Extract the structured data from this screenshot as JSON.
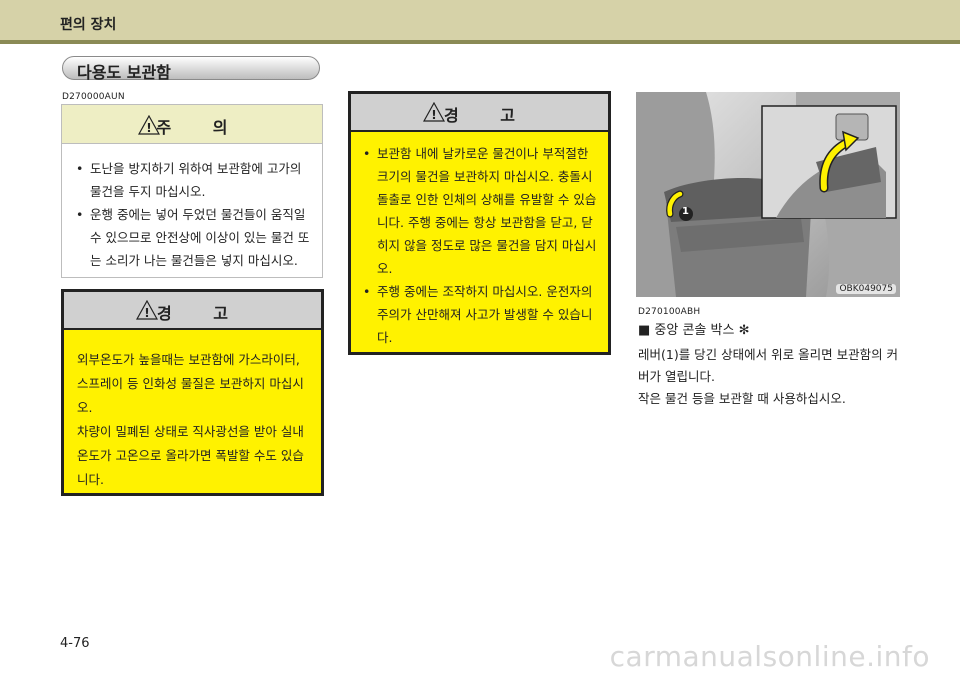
{
  "header": {
    "title": "편의 장치"
  },
  "section": {
    "title": "다용도 보관함"
  },
  "codes": {
    "caution": "D270000AUN",
    "console": "D270100ABH"
  },
  "caution": {
    "title": "주 의",
    "items": [
      "도난을 방지하기 위하여 보관함에 고가의 물건을 두지 마십시오.",
      "운행 중에는 넣어 두었던 물건들이 움직일 수 있으므로 안전상에 이상이 있는 물건 또는 소리가 나는 물건들은 넣지 마십시오."
    ]
  },
  "warning_left": {
    "title": "경 고",
    "paragraphs": [
      "외부온도가 높을때는 보관함에 가스라이터, 스프레이 등 인화성 물질은 보관하지 마십시오.",
      "차량이 밀폐된 상태로 직사광선을 받아 실내 온도가 고온으로 올라가면 폭발할 수도 있습니다."
    ]
  },
  "warning_middle": {
    "title": "경 고",
    "items": [
      "보관함 내에 날카로운 물건이나 부적절한 크기의 물건을 보관하지 마십시오. 충돌시 돌출로 인한 인체의 상해를 유발할 수 있습니다. 주행 중에는 항상 보관함을 닫고, 닫히지 않을 정도로 많은 물건을 담지 마십시오.",
      "주행 중에는 조작하지 마십시오. 운전자의 주의가 산만해져 사고가 발생할 수 있습니다."
    ]
  },
  "figure": {
    "code": "OBK049075",
    "callout": "1"
  },
  "console": {
    "title": "■ 중앙 콘솔 박스 ✻",
    "body": [
      "레버(1)를 당긴 상태에서 위로 올리면 보관함의 커버가 열립니다.",
      "작은 물건 등을 보관할 때 사용하십시오."
    ]
  },
  "footer": {
    "page": "4-76",
    "watermark": "carmanualsonline.info"
  }
}
